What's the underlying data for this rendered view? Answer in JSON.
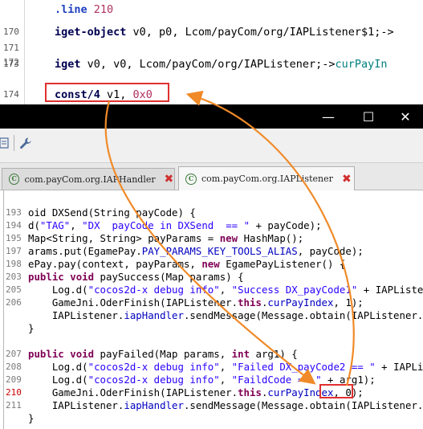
{
  "smali": {
    "lines": [
      {
        "num": "",
        "parts": [
          {
            "t": ".line ",
            "c": "kw-dir"
          },
          {
            "t": "210",
            "c": "num"
          }
        ]
      },
      {
        "num": "170",
        "parts": [
          {
            "t": "iget-object ",
            "c": "kw-op"
          },
          {
            "t": "v0, p0, Lcom/payCom/org/IAPListener$1;->",
            "c": "ref"
          }
        ]
      },
      {
        "num": "171",
        "parts": []
      },
      {
        "num": "172",
        "parts": []
      },
      {
        "num": "173",
        "parts": [
          {
            "t": "iget ",
            "c": "kw-op"
          },
          {
            "t": "v0, v0, Lcom/payCom/org/IAPListener;->",
            "c": "ref"
          },
          {
            "t": "curPayIn",
            "c": "arrowref"
          }
        ]
      },
      {
        "num": "",
        "parts": []
      },
      {
        "num": "174",
        "parts": [
          {
            "t": "const/4 ",
            "c": "kw-op"
          },
          {
            "t": "v1, ",
            "c": "reg"
          },
          {
            "t": "0x0",
            "c": "num"
          }
        ]
      }
    ]
  },
  "titlebar": {
    "minimize": "—",
    "maximize": "☐",
    "close": "✕"
  },
  "tabs": [
    {
      "label": "com.payCom.org.IAPHandler",
      "active": false
    },
    {
      "label": "com.payCom.org.IAPListener",
      "active": true
    }
  ],
  "java": {
    "lines": [
      {
        "num": "",
        "code": ""
      },
      {
        "num": "193",
        "code": "oid DXSend(String payCode) {"
      },
      {
        "num": "194",
        "code": "d(\"TAG\", \"DX  payCode in DXSend  == \" + payCode);"
      },
      {
        "num": "195",
        "code": "Map<String, String> payParams = new HashMap();"
      },
      {
        "num": "197",
        "code": "arams.put(EgamePay.PAY_PARAMS_KEY_TOOLS_ALIAS, payCode);"
      },
      {
        "num": "198",
        "code": "ePay.pay(context, payParams, new EgamePayListener() {"
      },
      {
        "num": "203",
        "code": "public void paySuccess(Map params) {"
      },
      {
        "num": "205",
        "code": "    Log.d(\"cocos2d-x debug info\", \"Success DX_payCode1\" + IAPListen"
      },
      {
        "num": "206",
        "code": "    GameJni.OderFinish(IAPListener.this.curPayIndex, 1);"
      },
      {
        "num": "",
        "code": "    IAPListener.iapHandler.sendMessage(Message.obtain(IAPListener.i"
      },
      {
        "num": "",
        "code": "}"
      },
      {
        "num": "",
        "code": ""
      },
      {
        "num": "207",
        "code": "public void payFailed(Map params, int arg1) {"
      },
      {
        "num": "208",
        "code": "    Log.d(\"cocos2d-x debug info\", \"Failed DX_payCode2 == \" + IAPLis"
      },
      {
        "num": "209",
        "code": "    Log.d(\"cocos2d-x debug info\", \"FaildCode == \" + arg1);"
      },
      {
        "num": "210",
        "code": "    GameJni.OderFinish(IAPListener.this.curPayIndex, 0);"
      },
      {
        "num": "211",
        "code": "    IAPListener.iapHandler.sendMessage(Message.obtain(IAPListener.i"
      },
      {
        "num": "",
        "code": "}"
      }
    ]
  },
  "colors": {
    "annotation_box": "#e03030",
    "arrow": "#f08a28"
  },
  "icons": [
    "window-minimize-icon",
    "window-maximize-icon",
    "window-close-icon",
    "wrench-icon",
    "class-icon",
    "tab-close-icon"
  ]
}
